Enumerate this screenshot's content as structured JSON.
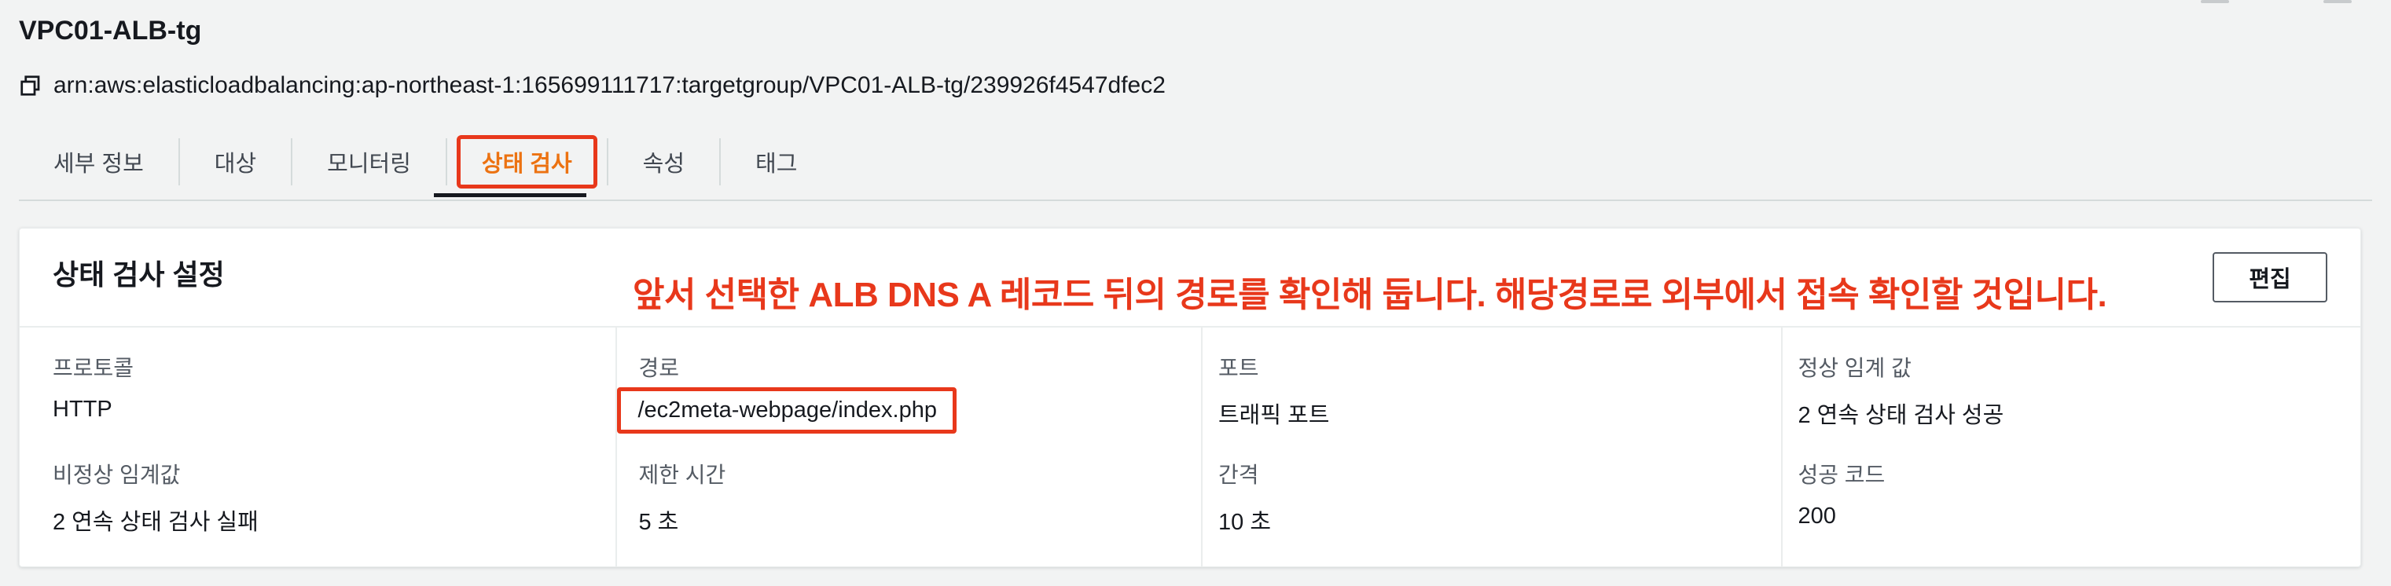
{
  "header": {
    "title": "VPC01-ALB-tg",
    "arn": "arn:aws:elasticloadbalancing:ap-northeast-1:165699111717:targetgroup/VPC01-ALB-tg/239926f4547dfec2"
  },
  "tabs": [
    {
      "label": "세부 정보"
    },
    {
      "label": "대상"
    },
    {
      "label": "모니터링"
    },
    {
      "label": "상태 검사"
    },
    {
      "label": "속성"
    },
    {
      "label": "태그"
    }
  ],
  "panel": {
    "title": "상태 검사 설정",
    "annotation": "앞서 선택한 ALB DNS A 레코드 뒤의 경로를 확인해 둡니다. 해당경로로 외부에서 접속 확인할 것입니다.",
    "edit_label": "편집",
    "fields": {
      "protocol": {
        "label": "프로토콜",
        "value": "HTTP"
      },
      "path": {
        "label": "경로",
        "value": "/ec2meta-webpage/index.php"
      },
      "port": {
        "label": "포트",
        "value": "트래픽 포트"
      },
      "healthy_threshold": {
        "label": "정상 임계 값",
        "value": "2 연속 상태 검사 성공"
      },
      "unhealthy_threshold": {
        "label": "비정상 임계값",
        "value": "2 연속 상태 검사 실패"
      },
      "timeout": {
        "label": "제한 시간",
        "value": "5 초"
      },
      "interval": {
        "label": "간격",
        "value": "10 초"
      },
      "success_codes": {
        "label": "성공 코드",
        "value": "200"
      }
    }
  },
  "colors": {
    "accent": "#ec7211",
    "annotation": "#e8381b",
    "text": "#16191f",
    "muted": "#545b64"
  },
  "icons": {
    "copy": "copy-icon"
  }
}
